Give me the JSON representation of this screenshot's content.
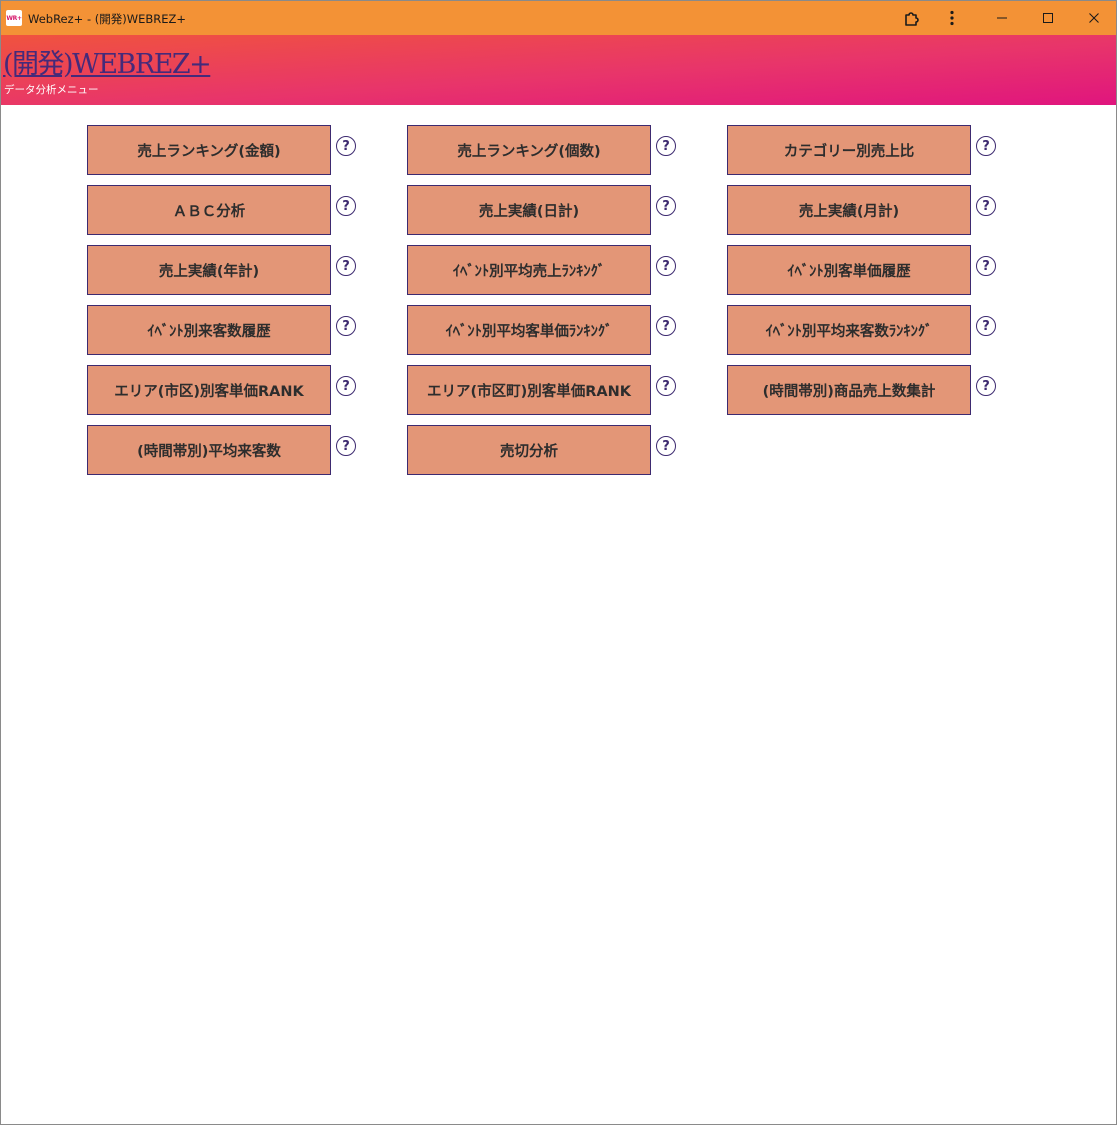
{
  "window": {
    "title": "WebRez+ - (開発)WEBREZ+",
    "app_icon_text": "WR+",
    "icons": [
      "extension-icon",
      "more-vert-icon",
      "minimize-icon",
      "maximize-icon",
      "close-icon"
    ]
  },
  "header": {
    "brand": "(開発)WEBREZ+",
    "subtitle": "データ分析メニュー"
  },
  "colors": {
    "titlebar": "#f39236",
    "header_start": "#f0533e",
    "header_end": "#e0157e",
    "button_bg": "#e39677",
    "button_border": "#3d2a70",
    "link": "#452a7a"
  },
  "menu": {
    "help_label": "?",
    "items": [
      {
        "label": "売上ランキング(金額)"
      },
      {
        "label": "売上ランキング(個数)"
      },
      {
        "label": "カテゴリー別売上比"
      },
      {
        "label": "ＡＢＣ分析"
      },
      {
        "label": "売上実績(日計)"
      },
      {
        "label": "売上実績(月計)"
      },
      {
        "label": "売上実績(年計)"
      },
      {
        "label": "ｲﾍﾞﾝﾄ別平均売上ﾗﾝｷﾝｸﾞ"
      },
      {
        "label": "ｲﾍﾞﾝﾄ別客単価履歴"
      },
      {
        "label": "ｲﾍﾞﾝﾄ別来客数履歴"
      },
      {
        "label": "ｲﾍﾞﾝﾄ別平均客単価ﾗﾝｷﾝｸﾞ"
      },
      {
        "label": "ｲﾍﾞﾝﾄ別平均来客数ﾗﾝｷﾝｸﾞ"
      },
      {
        "label": "エリア(市区)別客単価RANK"
      },
      {
        "label": "エリア(市区町)別客単価RANK"
      },
      {
        "label": "(時間帯別)商品売上数集計"
      },
      {
        "label": "(時間帯別)平均来客数"
      },
      {
        "label": "売切分析"
      }
    ]
  }
}
